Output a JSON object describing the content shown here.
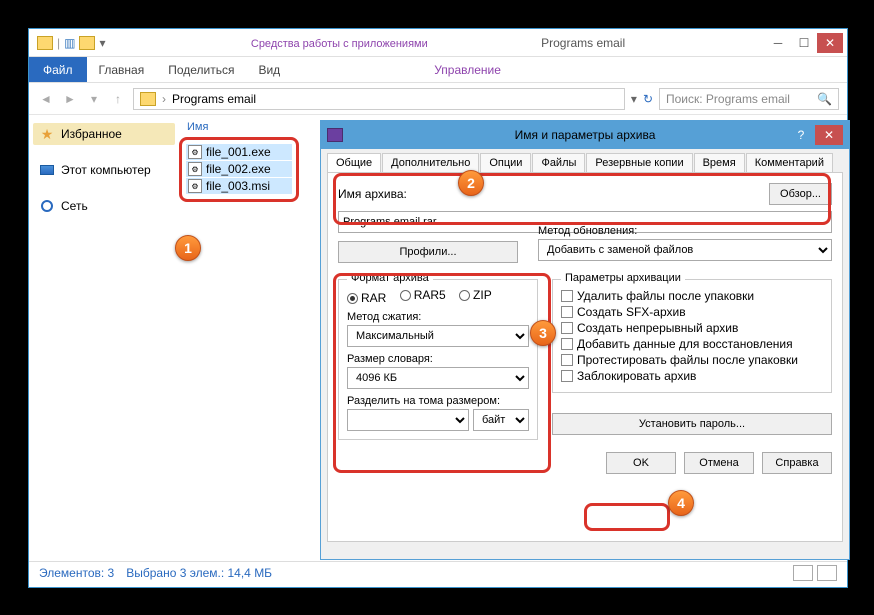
{
  "window": {
    "tool_context": "Средства работы с приложениями",
    "title": "Programs email",
    "ribbon": {
      "file": "Файл",
      "home": "Главная",
      "share": "Поделиться",
      "view": "Вид",
      "manage": "Управление"
    },
    "path_label": "Programs email",
    "search_placeholder": "Поиск: Programs email"
  },
  "sidebar": {
    "favorites": "Избранное",
    "computer": "Этот компьютер",
    "network": "Сеть"
  },
  "filelist": {
    "header_name": "Имя",
    "files": [
      "file_001.exe",
      "file_002.exe",
      "file_003.msi"
    ]
  },
  "statusbar": {
    "count": "Элементов: 3",
    "selection": "Выбрано 3 элем.: 14,4 МБ"
  },
  "dialog": {
    "title": "Имя и параметры архива",
    "tabs": {
      "general": "Общие",
      "advanced": "Дополнительно",
      "options": "Опции",
      "files": "Файлы",
      "backup": "Резервные копии",
      "time": "Время",
      "comment": "Комментарий"
    },
    "archive_name_label": "Имя архива:",
    "browse": "Обзор...",
    "archive_name": "Programs email.rar",
    "profiles": "Профили...",
    "update_method_label": "Метод обновления:",
    "update_method": "Добавить с заменой файлов",
    "format_label": "Формат архива",
    "formats": {
      "rar": "RAR",
      "rar5": "RAR5",
      "zip": "ZIP"
    },
    "compression_label": "Метод сжатия:",
    "compression": "Максимальный",
    "dict_label": "Размер словаря:",
    "dict": "4096 КБ",
    "split_label": "Разделить на тома размером:",
    "split_unit": "байт",
    "arch_params_label": "Параметры архивации",
    "opts": {
      "delete": "Удалить файлы после упаковки",
      "sfx": "Создать SFX-архив",
      "solid": "Создать непрерывный архив",
      "recovery": "Добавить данные для восстановления",
      "test": "Протестировать файлы после упаковки",
      "lock": "Заблокировать архив"
    },
    "set_password": "Установить пароль...",
    "ok": "OK",
    "cancel": "Отмена",
    "help": "Справка"
  },
  "callouts": {
    "c1": "1",
    "c2": "2",
    "c3": "3",
    "c4": "4"
  }
}
